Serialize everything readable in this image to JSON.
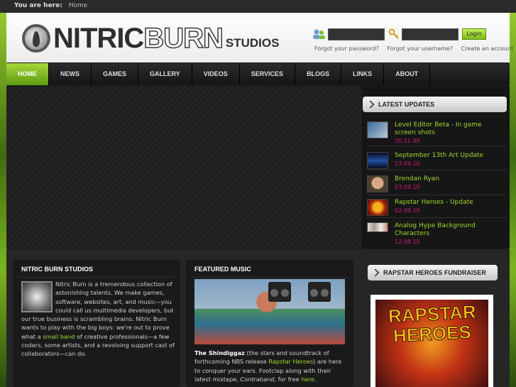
{
  "breadcrumb": {
    "label": "You are here:",
    "current": "Home"
  },
  "brand": {
    "part1": "NITRIC",
    "part2": "BURN",
    "part3": "STUDIOS"
  },
  "login": {
    "button": "Login",
    "links": [
      "Forgot your password?",
      "Forgot your username?",
      "Create an account"
    ]
  },
  "nav": [
    "HOME",
    "NEWS",
    "GAMES",
    "GALLERY",
    "VIDEOS",
    "SERVICES",
    "BLOGS",
    "LINKS",
    "ABOUT"
  ],
  "updates": {
    "title": "LATEST UPDATES",
    "items": [
      {
        "title": "Level Editor Beta - In game screen shots",
        "date": "30.11.99"
      },
      {
        "title": "September 13th Art Update",
        "date": "13.09.10"
      },
      {
        "title": "Brendan Ryan",
        "date": "03.09.10"
      },
      {
        "title": "Rapstar Heroes - Update",
        "date": "02.09.10"
      },
      {
        "title": "Analog Hype Background Characters",
        "date": "12.08.10"
      }
    ]
  },
  "about": {
    "title": "NITRIC BURN STUDIOS",
    "text1": "Nitric Burn is a tremendous collection of astonishing talents. We make games, software, websites, art, and music—you could call us multimedia developers, but our true business is scrambling brains. Nitric Burn wants to play with the big boys: we're out to prove what a ",
    "link": "small band",
    "text2": " of creative professionals—a few coders, some artists, and a revolving support cast of collaborators—can do."
  },
  "music": {
    "title": "FEATURED MUSIC",
    "band": "The Shindiggaz",
    "text1": " (the stars and soundtrack of forthcoming NBS release ",
    "link1": "Rapstar Heroes",
    "text2": ") are here to conquer your ears. Footclap along with their latest mixtape, ",
    "mixtape": "Contraband",
    "text3": ", for free ",
    "link2": "here",
    "text4": "."
  },
  "fundraiser": {
    "title": "RAPSTAR HEROES FUNDRAISER",
    "art_line1": "RAPSTAR",
    "art_line2": "HEROES"
  },
  "colors": {
    "accent_green": "#a3d62e",
    "date_pink": "#d2197c"
  }
}
